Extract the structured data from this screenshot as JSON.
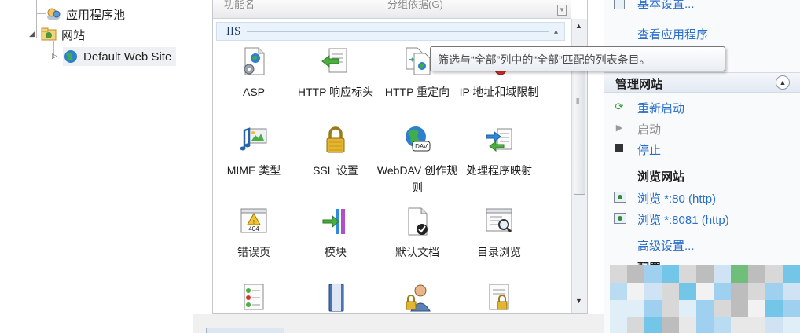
{
  "tree": {
    "app_pools_label": "应用程序池",
    "sites_label": "网站",
    "default_site_label": "Default Web Site"
  },
  "features": {
    "columns": {
      "name": "功能名",
      "group_by": "分组依据(G)"
    },
    "group_label": "IIS",
    "tiles": [
      {
        "label": "ASP"
      },
      {
        "label": "HTTP 响应标头"
      },
      {
        "label": "HTTP 重定向"
      },
      {
        "label": "IP 地址和域限制"
      },
      {
        "label": "MIME 类型"
      },
      {
        "label": "SSL 设置"
      },
      {
        "label": "WebDAV 创作规则"
      },
      {
        "label": "处理程序映射"
      },
      {
        "label": "错误页"
      },
      {
        "label": "模块"
      },
      {
        "label": "默认文档"
      },
      {
        "label": "目录浏览"
      }
    ],
    "webdav_badge": "DAV",
    "error_badge": "404",
    "tooltip": "筛选与“全部”列中的“全部”匹配的列表条目。"
  },
  "actions": {
    "basic_settings": "基本设置...",
    "view_apps": "查看应用程序",
    "manage_site": {
      "title": "管理网站",
      "restart": "重新启动",
      "start": "启动",
      "stop": "停止",
      "browse_title": "浏览网站",
      "browse_80": "浏览 *:80 (http)",
      "browse_8081": "浏览 *:8081 (http)",
      "advanced": "高级设置..."
    },
    "configure_title": "配置"
  },
  "colors": {
    "link": "#2a6fc9",
    "group_header": "#eaf3fb",
    "disabled": "#8f8f8f"
  }
}
